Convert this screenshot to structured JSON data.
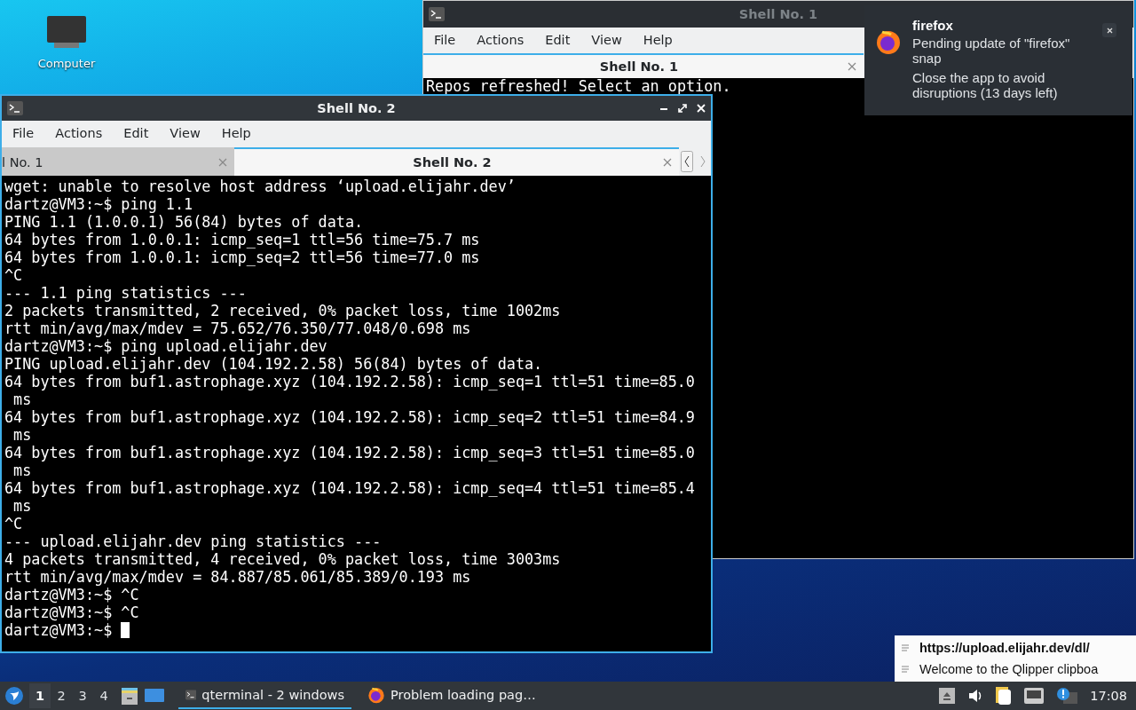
{
  "desktop_icons": [
    {
      "label": "Computer"
    }
  ],
  "windows": [
    {
      "title": "Shell No. 1",
      "active": false,
      "menu": [
        "File",
        "Actions",
        "Edit",
        "View",
        "Help"
      ],
      "tabs": [
        {
          "label": "Shell No. 1",
          "selected": true
        }
      ],
      "lines": [
        "Repos refreshed! Select an option."
      ]
    },
    {
      "title": "Shell No. 2",
      "active": true,
      "menu": [
        "File",
        "Actions",
        "Edit",
        "View",
        "Help"
      ],
      "tabs": [
        {
          "label": "l No. 1",
          "selected": false
        },
        {
          "label": "Shell No. 2",
          "selected": true
        }
      ],
      "lines": [
        "wget: unable to resolve host address ‘upload.elijahr.dev’",
        "dartz@VM3:~$ ping 1.1",
        "PING 1.1 (1.0.0.1) 56(84) bytes of data.",
        "64 bytes from 1.0.0.1: icmp_seq=1 ttl=56 time=75.7 ms",
        "64 bytes from 1.0.0.1: icmp_seq=2 ttl=56 time=77.0 ms",
        "^C",
        "--- 1.1 ping statistics ---",
        "2 packets transmitted, 2 received, 0% packet loss, time 1002ms",
        "rtt min/avg/max/mdev = 75.652/76.350/77.048/0.698 ms",
        "dartz@VM3:~$ ping upload.elijahr.dev",
        "PING upload.elijahr.dev (104.192.2.58) 56(84) bytes of data.",
        "64 bytes from buf1.astrophage.xyz (104.192.2.58): icmp_seq=1 ttl=51 time=85.0",
        " ms",
        "64 bytes from buf1.astrophage.xyz (104.192.2.58): icmp_seq=2 ttl=51 time=84.9",
        " ms",
        "64 bytes from buf1.astrophage.xyz (104.192.2.58): icmp_seq=3 ttl=51 time=85.0",
        " ms",
        "64 bytes from buf1.astrophage.xyz (104.192.2.58): icmp_seq=4 ttl=51 time=85.4",
        " ms",
        "^C",
        "--- upload.elijahr.dev ping statistics ---",
        "4 packets transmitted, 4 received, 0% packet loss, time 3003ms",
        "rtt min/avg/max/mdev = 84.887/85.061/85.389/0.193 ms",
        "dartz@VM3:~$ ^C",
        "dartz@VM3:~$ ^C",
        "dartz@VM3:~$ "
      ]
    }
  ],
  "notification": {
    "app": "firefox",
    "message": "Pending update of \"firefox\" snap",
    "detail": "Close the app to avoid disruptions (13 days left)"
  },
  "clipboard_menu": {
    "items": [
      {
        "label": "https://upload.elijahr.dev/dl/",
        "selected": true
      },
      {
        "label": "Welcome to the Qlipper clipboa",
        "selected": false
      }
    ]
  },
  "taskbar": {
    "desktops": [
      {
        "label": "1",
        "selected": true
      },
      {
        "label": "2",
        "selected": false
      },
      {
        "label": "3",
        "selected": false
      },
      {
        "label": "4",
        "selected": false
      }
    ],
    "tasks": [
      {
        "label": "qterminal - 2 windows",
        "selected": true,
        "kind": "terminal"
      },
      {
        "label": "Problem loading pag…",
        "selected": false,
        "kind": "browser"
      }
    ],
    "clock": "17:08"
  }
}
